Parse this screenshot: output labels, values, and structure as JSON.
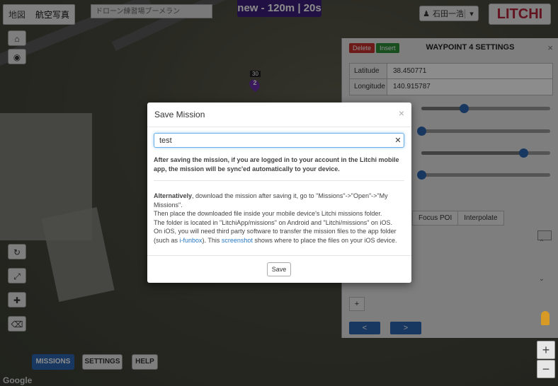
{
  "map": {
    "type_tabs": [
      "地図",
      "航空写真"
    ],
    "search_text": "ドローン練習場ブーメラン",
    "google_label": "Google",
    "marker_number": "2",
    "marker_altitude": "30"
  },
  "header": {
    "mission_banner": "new - 120m | 20s",
    "user_name": "石田一浩",
    "logo_text": "LITCHI"
  },
  "bottom_buttons": {
    "missions": "MISSIONS",
    "settings": "SETTINGS",
    "help": "HELP"
  },
  "zoom": {
    "in": "+",
    "out": "−"
  },
  "waypoint_panel": {
    "delete_label": "Delete",
    "insert_label": "Insert",
    "title": "WAYPOINT 4 SETTINGS",
    "latitude_label": "Latitude",
    "latitude_value": "38.450771",
    "longitude_label": "Longitude",
    "longitude_value": "140.915787",
    "sliders": [
      0.33,
      0.0,
      0.79,
      0.0
    ],
    "tabs": [
      "Focus POI",
      "Interpolate"
    ],
    "add_label": "+",
    "prev_label": "<",
    "next_label": ">"
  },
  "save_modal": {
    "title": "Save Mission",
    "input_value": "test",
    "notice": "After saving the mission, if you are logged in to your account in the Litchi mobile app, the mission will be sync'ed automatically to your device.",
    "info_alt_bold": "Alternatively",
    "info_line1": ", download the mission after saving it, go to \"Missions\"->\"Open\"->\"My Missions\".",
    "info_line2": "Then place the downloaded file inside your mobile device's Litchi missions folder.",
    "info_line3": "The folder is located in \"LitchiApp/missions\" on Android and \"Litchi/missions\" on iOS.",
    "info_line4a": "On iOS, you will need third party software to transfer the mission files to the app folder (such as ",
    "info_link1": "i-funbox",
    "info_line4b": "). This ",
    "info_link2": "screenshot",
    "info_line4c": " shows where to place the files on your iOS device.",
    "save_label": "Save"
  }
}
